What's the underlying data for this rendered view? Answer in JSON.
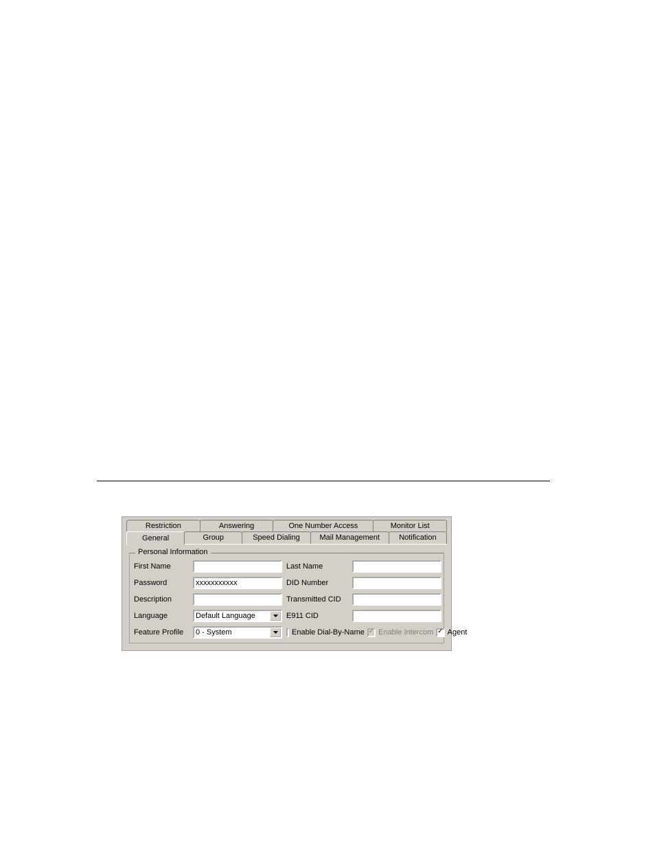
{
  "tabs_row_back": [
    {
      "label": "Restriction"
    },
    {
      "label": "Answering"
    },
    {
      "label": "One Number Access"
    },
    {
      "label": "Monitor List"
    }
  ],
  "tabs_row_front": [
    {
      "label": "General",
      "active": true
    },
    {
      "label": "Group"
    },
    {
      "label": "Speed Dialing"
    },
    {
      "label": "Mail Management"
    },
    {
      "label": "Notification"
    }
  ],
  "groupbox": {
    "legend": "Personal Information"
  },
  "labels": {
    "first_name": "First Name",
    "last_name": "Last Name",
    "password": "Password",
    "did_number": "DID Number",
    "description": "Description",
    "transmitted_cid": "Transmitted CID",
    "language": "Language",
    "e911_cid": "E911 CID",
    "feature_profile": "Feature Profile"
  },
  "values": {
    "first_name": "",
    "last_name": "",
    "password": "xxxxxxxxxxx",
    "did_number": "",
    "description": "",
    "transmitted_cid": "",
    "language_selected": "Default Language",
    "e911_cid": "",
    "feature_profile_selected": "0 - System"
  },
  "checks": {
    "enable_dial_by_name": {
      "label": "Enable Dial-By-Name",
      "checked": false,
      "disabled": false
    },
    "enable_intercom": {
      "label": "Enable Intercom",
      "checked": true,
      "disabled": true
    },
    "agent": {
      "label": "Agent",
      "checked": true,
      "disabled": false
    }
  }
}
